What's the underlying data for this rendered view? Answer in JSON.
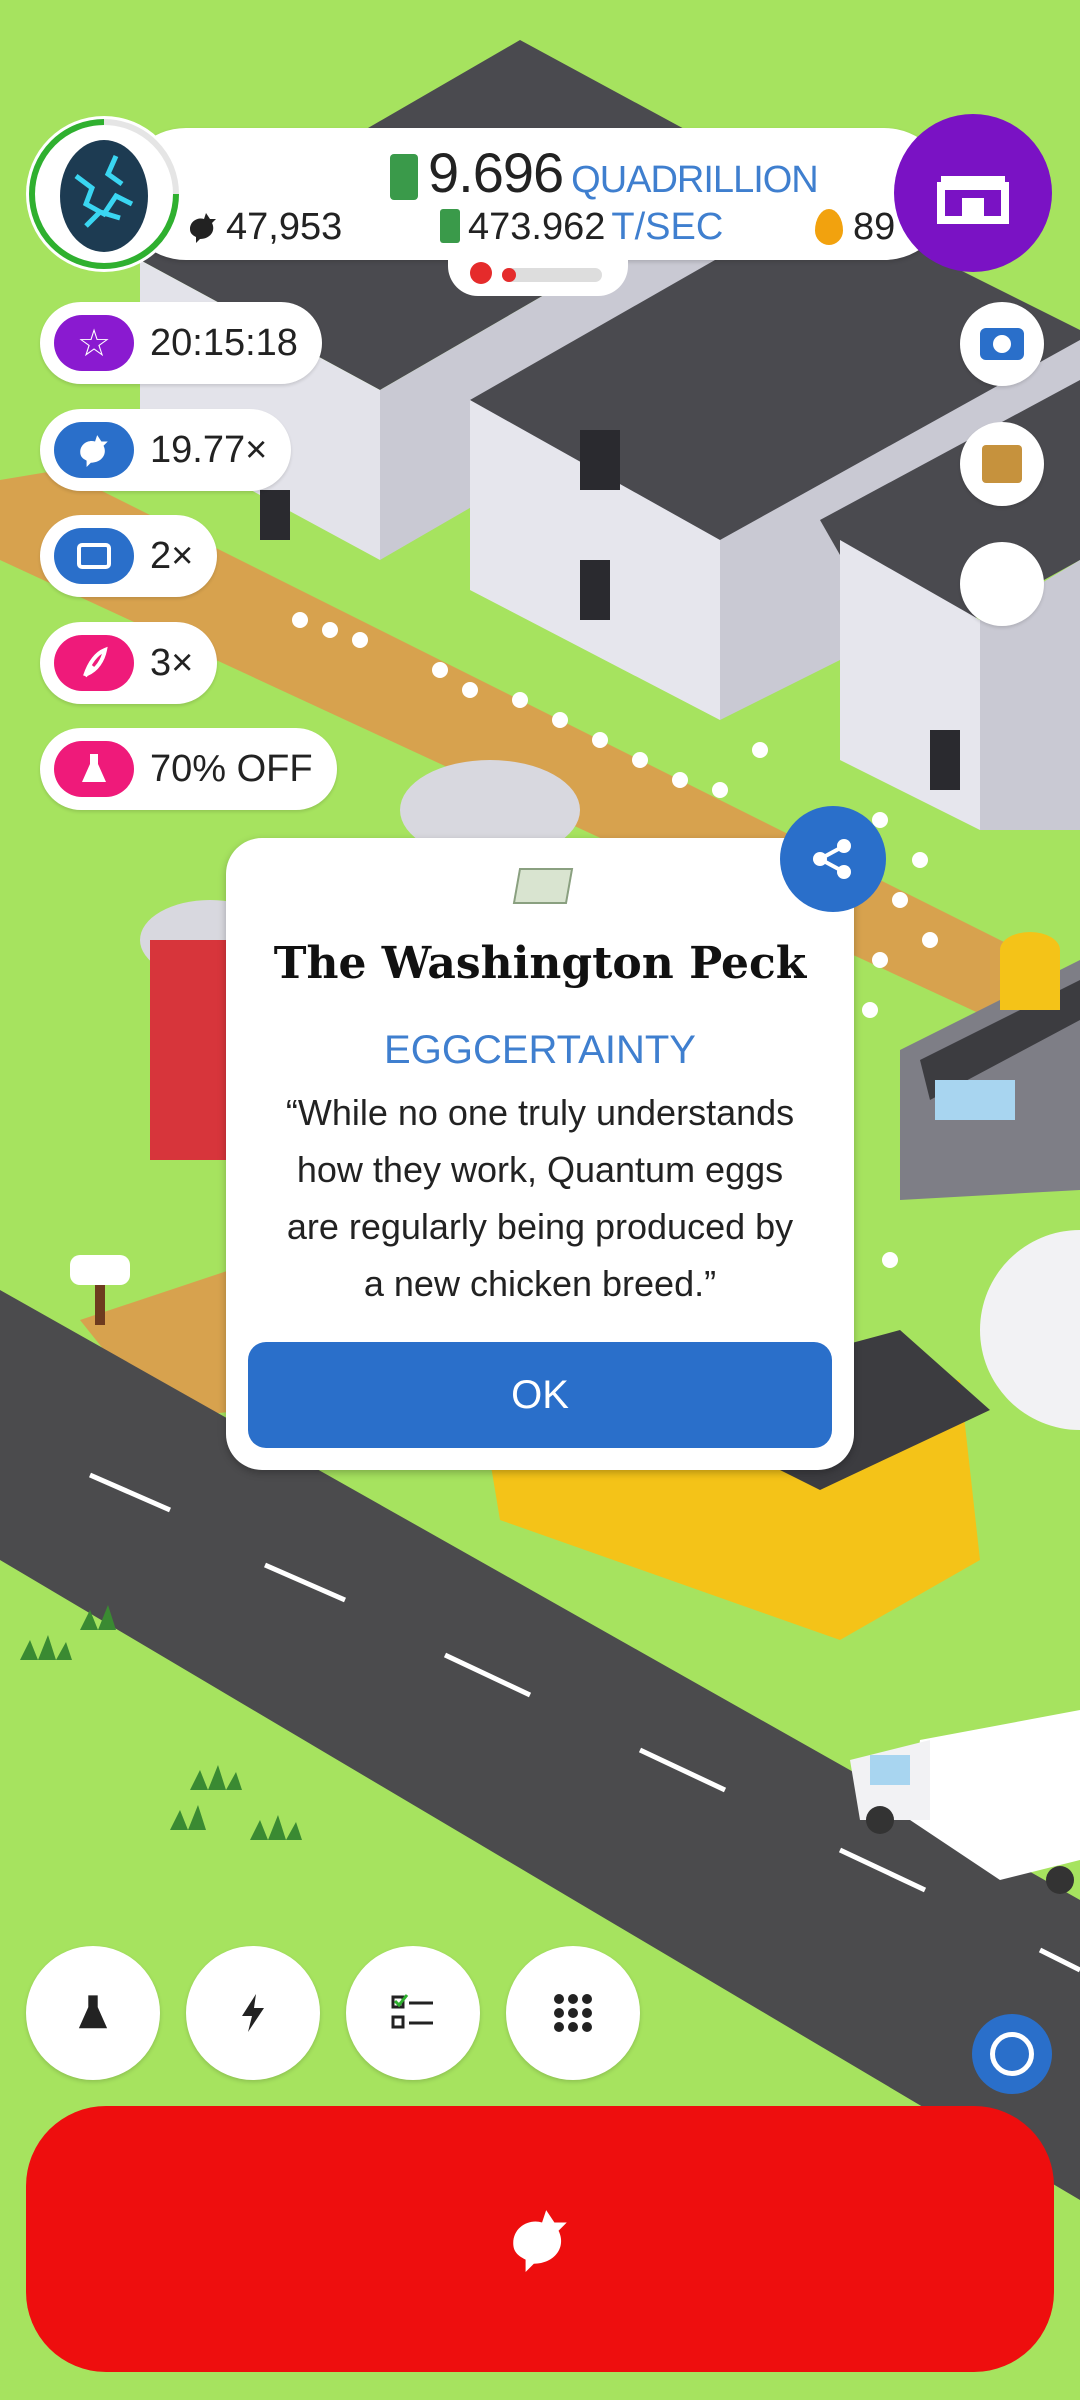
{
  "top_bar": {
    "money_value": "9.696",
    "money_unit": "QUADRILLION",
    "chicken_count": "47,953",
    "rate_value": "473.962",
    "rate_unit": "T/SEC",
    "golden_eggs": "89"
  },
  "boosts": [
    {
      "icon": "star-icon",
      "label": "20:15:18",
      "color": "#8a1ad0"
    },
    {
      "icon": "chicken-icon",
      "label": "19.77×",
      "color": "#2a6fca"
    },
    {
      "icon": "video-icon",
      "label": "2×",
      "color": "#2a6fca"
    },
    {
      "icon": "feather-icon",
      "label": "3×",
      "color": "#ef1a7a"
    },
    {
      "icon": "flask-icon",
      "label": "70% OFF",
      "color": "#ef1a7a"
    }
  ],
  "news_modal": {
    "publication": "The Washington Peck",
    "headline": "EGGCERTAINTY",
    "body": "“While no one truly understands how they work, Quantum eggs are regularly being produced by a new chicken breed.”",
    "ok_label": "OK"
  },
  "colors": {
    "grass": "#a6e35f",
    "accent_blue": "#2a6fca",
    "hatch_red": "#ee0e0e",
    "shop_purple": "#7a12c4"
  },
  "bottom_buttons": [
    "research-button",
    "boost-button",
    "missions-button",
    "menu-button"
  ]
}
